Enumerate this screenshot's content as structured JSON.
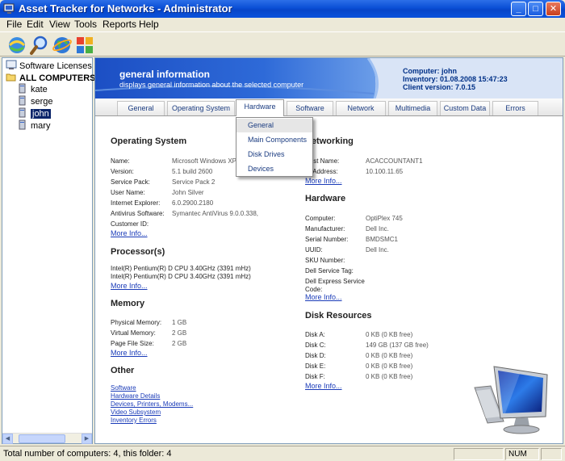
{
  "window": {
    "title": "Asset Tracker for Networks - Administrator"
  },
  "menu": [
    "File",
    "Edit",
    "View",
    "Tools",
    "Reports",
    "Help"
  ],
  "toolbar": {
    "icons": [
      "network-scan-icon",
      "search-icon",
      "globe-icon",
      "reports-icon"
    ]
  },
  "tree": {
    "software_licenses": "Software Licenses",
    "all_computers": "ALL COMPUTERS",
    "computers": [
      "kate",
      "serge",
      "john",
      "mary"
    ],
    "selected": "john"
  },
  "banner": {
    "title": "general information",
    "subtitle": "displays general information about the selected computer",
    "computer": "Computer: john",
    "inventory": "Inventory: 01.08.2008 15:47:23",
    "client_version": "Client version: 7.0.15"
  },
  "tabs": [
    "General",
    "Operating System",
    "Hardware",
    "Software",
    "Network",
    "Multimedia",
    "Custom Data",
    "Errors"
  ],
  "active_tab": "Hardware",
  "dropdown": [
    "General",
    "Main Components",
    "Disk Drives",
    "Devices"
  ],
  "os": {
    "heading": "Operating System",
    "rows": [
      {
        "label": "Name:",
        "value": "Microsoft Windows XP"
      },
      {
        "label": "Version:",
        "value": "5.1 build 2600"
      },
      {
        "label": "Service Pack:",
        "value": "Service Pack 2"
      },
      {
        "label": "User Name:",
        "value": "John Silver"
      },
      {
        "label": "Internet Explorer:",
        "value": "6.0.2900.2180"
      },
      {
        "label": "Antivirus Software:",
        "value": "Symantec AntiVirus 9.0.0.338,"
      },
      {
        "label": "Customer ID:",
        "value": ""
      }
    ],
    "more": "More Info..."
  },
  "processors": {
    "heading": "Processor(s)",
    "lines": [
      "Intel(R) Pentium(R) D CPU 3.40GHz (3391 mHz)",
      "Intel(R) Pentium(R) D CPU 3.40GHz (3391 mHz)"
    ],
    "more": "More Info..."
  },
  "memory": {
    "heading": "Memory",
    "rows": [
      {
        "label": "Physical Memory:",
        "value": "1 GB"
      },
      {
        "label": "Virtual Memory:",
        "value": "2 GB"
      },
      {
        "label": "Page File Size:",
        "value": "2 GB"
      }
    ],
    "more": "More Info..."
  },
  "other": {
    "heading": "Other",
    "links": [
      "Software",
      "Hardware Details",
      "Devices, Printers, Modems...",
      "Video Subsystem",
      "Inventory Errors"
    ]
  },
  "networking": {
    "heading": "Networking",
    "rows": [
      {
        "label": "Host Name:",
        "value": "ACACCOUNTANT1"
      },
      {
        "label": "IP Address:",
        "value": "10.100.11.65"
      }
    ],
    "more": "More Info..."
  },
  "hardware": {
    "heading": "Hardware",
    "rows": [
      {
        "label": "Computer:",
        "value": "OptiPlex 745"
      },
      {
        "label": "Manufacturer:",
        "value": "Dell Inc."
      },
      {
        "label": "Serial Number:",
        "value": "BMDSMC1"
      },
      {
        "label": "UUID:",
        "value": "Dell Inc."
      },
      {
        "label": "SKU Number:",
        "value": ""
      },
      {
        "label": "Dell Service Tag:",
        "value": ""
      },
      {
        "label": "Dell Express Service",
        "value": ""
      },
      {
        "label": "Code:",
        "value": ""
      }
    ],
    "more": "More Info..."
  },
  "disks": {
    "heading": "Disk Resources",
    "rows": [
      {
        "label": "Disk A:",
        "value": "0 KB (0 KB free)"
      },
      {
        "label": "Disk C:",
        "value": "149 GB (137 GB free)"
      },
      {
        "label": "Disk D:",
        "value": "0 KB (0 KB free)"
      },
      {
        "label": "Disk E:",
        "value": "0 KB (0 KB free)"
      },
      {
        "label": "Disk F:",
        "value": "0 KB (0 KB free)"
      }
    ],
    "more": "More Info..."
  },
  "status": {
    "text": "Total number of computers: 4, this folder: 4",
    "num": "NUM"
  }
}
